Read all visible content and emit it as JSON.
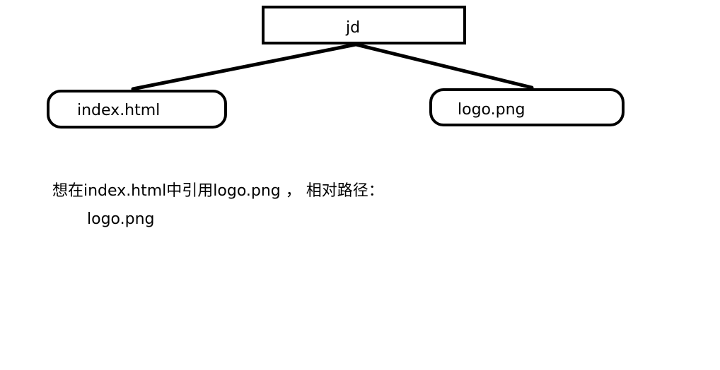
{
  "diagram": {
    "nodes": {
      "root": {
        "label": "jd"
      },
      "left_child": {
        "label": "index.html"
      },
      "right_child": {
        "label": "logo.png"
      }
    },
    "stroke_color": "#000000",
    "background_color": "#ffffff"
  },
  "note": {
    "question": "想在index.html中引用logo.png ， 相对路径：",
    "answer": "logo.png"
  }
}
